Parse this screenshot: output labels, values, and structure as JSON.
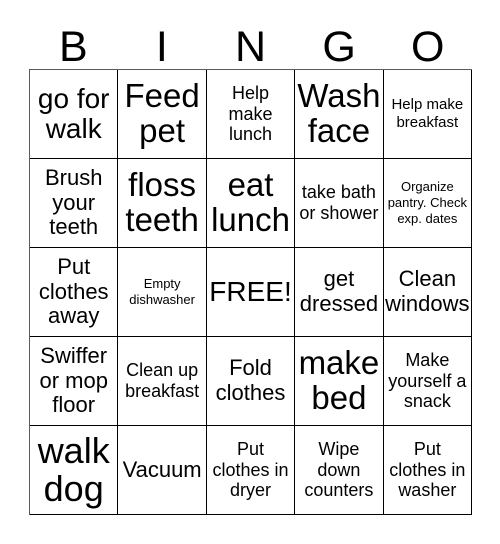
{
  "card": {
    "headers": [
      "B",
      "I",
      "N",
      "G",
      "O"
    ],
    "rows": [
      [
        {
          "text": "go for walk",
          "size": "lg"
        },
        {
          "text": "Feed pet",
          "size": "xl"
        },
        {
          "text": "Help make lunch",
          "size": "sm"
        },
        {
          "text": "Wash face",
          "size": "xl"
        },
        {
          "text": "Help make breakfast",
          "size": "xs"
        }
      ],
      [
        {
          "text": "Brush your teeth",
          "size": "md"
        },
        {
          "text": "floss teeth",
          "size": "xl"
        },
        {
          "text": "eat lunch",
          "size": "xl"
        },
        {
          "text": "take bath or shower",
          "size": "sm"
        },
        {
          "text": "Organize pantry. Check exp. dates",
          "size": "xxs"
        }
      ],
      [
        {
          "text": "Put clothes away",
          "size": "md"
        },
        {
          "text": "Empty dishwasher",
          "size": "xxs"
        },
        {
          "text": "FREE!",
          "size": "lg"
        },
        {
          "text": "get dressed",
          "size": "md"
        },
        {
          "text": "Clean windows",
          "size": "md"
        }
      ],
      [
        {
          "text": "Swiffer or mop floor",
          "size": "md"
        },
        {
          "text": "Clean up breakfast",
          "size": "sm"
        },
        {
          "text": "Fold clothes",
          "size": "md"
        },
        {
          "text": "make bed",
          "size": "xl"
        },
        {
          "text": "Make yourself a snack",
          "size": "sm"
        }
      ],
      [
        {
          "text": "walk dog",
          "size": "xxl"
        },
        {
          "text": "Vacuum",
          "size": "md"
        },
        {
          "text": "Put clothes in dryer",
          "size": "sm"
        },
        {
          "text": "Wipe down counters",
          "size": "sm"
        },
        {
          "text": "Put clothes in washer",
          "size": "sm"
        }
      ]
    ]
  }
}
